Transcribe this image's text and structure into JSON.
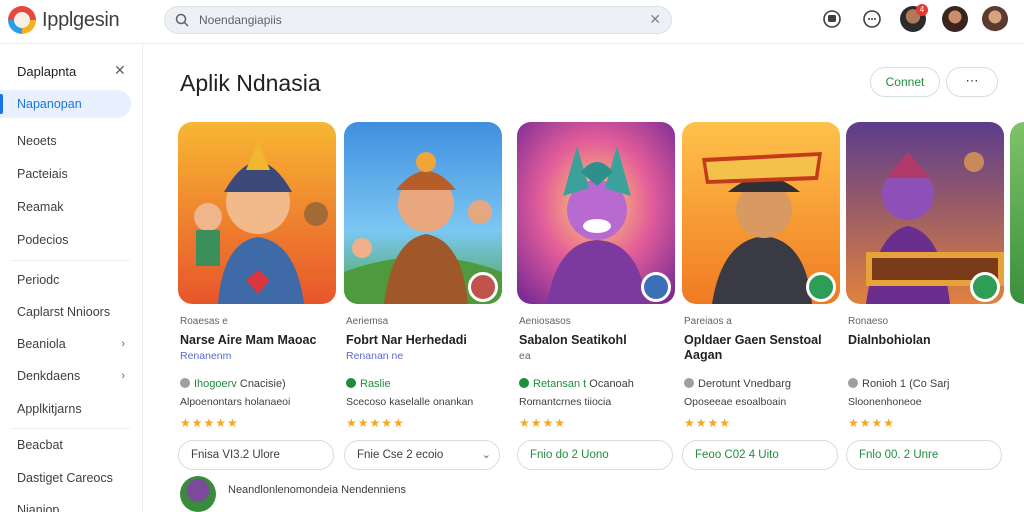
{
  "app": {
    "name": "Ipplgesin"
  },
  "search": {
    "value": "Noendangiapiis",
    "clear_glyph": "✕"
  },
  "topbar": {
    "notification_count": "4"
  },
  "sidebar": {
    "heading": "Daplapnta",
    "items": [
      {
        "label": "Napanopan",
        "active": true
      },
      {
        "label": "Neoets"
      },
      {
        "label": "Pacteiais"
      },
      {
        "label": "Reamak"
      },
      {
        "label": "Podecios"
      },
      {
        "label": "Periodc"
      },
      {
        "label": "Caplarst Nnioors"
      },
      {
        "label": "Beaniola",
        "chevron": true
      },
      {
        "label": "Denkdaens",
        "chevron": true
      },
      {
        "label": "Applkitjarns"
      },
      {
        "label": "Beacbat"
      },
      {
        "label": "Dastiget Careocs"
      },
      {
        "label": "Nianiop"
      }
    ]
  },
  "main": {
    "title": "Aplik Ndnasia",
    "connect_label": "Connet",
    "more_label": "⋯",
    "cards": [
      {
        "dev": "Roaesas e",
        "title": "Narse Aire Mam Maoac",
        "sub": "Renanenm",
        "cat": "Ihogoerv",
        "cat_extra": "Cnacisie)",
        "desc": "Alpoenontars holanaeoi",
        "stars": "★★★★★",
        "price": "Fnisa VI3.2 Ulore",
        "badge_color": "#2f7d6a"
      },
      {
        "dev": "Aeriemsa",
        "title": "Fobrt Nar Herhedadi",
        "sub": "Renanan ne",
        "cat": "Raslie",
        "cat_extra": "",
        "desc": "Scecoso kaselalle onankan",
        "stars": "★★★★★",
        "price": "Fnie Cse 2 ecoio",
        "badge_color": "#c0534b"
      },
      {
        "dev": "Aeniosasos",
        "title": "Sabalon Seatikohl",
        "sub": "ea",
        "cat": "Retansan t",
        "cat_extra": "Ocanoah",
        "desc": "Romantcrnes tiiocia",
        "stars": "★★★★",
        "price": "Fnio do 2 Uono",
        "badge_color": "#3b6fb8"
      },
      {
        "dev": "Pareiaos a",
        "title": "Opldaer Gaen Senstoal Aagan",
        "sub": "",
        "cat": "Derotunt",
        "cat_extra": "Vnedbarg",
        "desc": "Oposeeae esoalboain",
        "stars": "★★★★",
        "price": "Feoo C02 4 Uito",
        "badge_color": "#2e9d55"
      },
      {
        "dev": "Ronaeso",
        "title": "Dialnbohiolan",
        "sub": "",
        "cat": "Ronioh 1 (Co Sarj",
        "cat_extra": "",
        "desc": "Sloonenhoneoe",
        "stars": "★★★★",
        "price": "Fnlo 00. 2 Unre",
        "badge_color": "#2e9d55"
      }
    ],
    "footer_text": "Neandlonlenomondeia Nendenniens"
  },
  "colors": {
    "accent": "#1a73e8",
    "green": "#1e8e3e",
    "star": "#f6a623"
  }
}
